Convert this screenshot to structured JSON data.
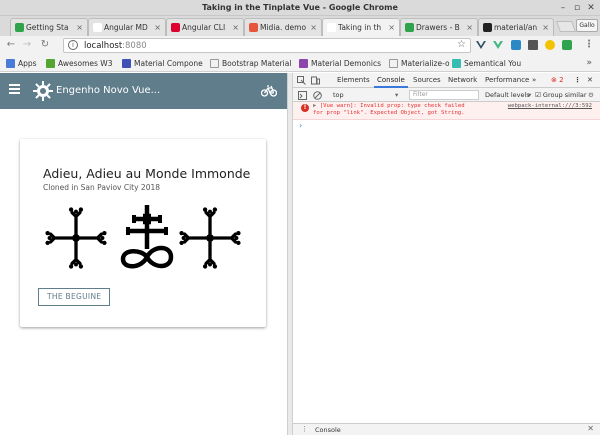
{
  "window": {
    "title": "Taking in the Tinplate Vue - Google Chrome"
  },
  "tabs": [
    {
      "label": "Getting Sta",
      "color": "#2fa34b"
    },
    {
      "label": "Angular MD",
      "color": "#ffffff"
    },
    {
      "label": "Angular CLI",
      "color": "#dd0031"
    },
    {
      "label": "Midia. demo",
      "color": "#e8553f"
    },
    {
      "label": "Taking in th",
      "color": "#ffffff",
      "active": true
    },
    {
      "label": "Drawers - B",
      "color": "#2fa34b"
    },
    {
      "label": "material/an",
      "color": "#222222"
    }
  ],
  "toolbar": {
    "url_host": "localhost",
    "url_port": ":8080",
    "profile_label": "Gallo"
  },
  "bookmarks": {
    "items": [
      {
        "label": "Apps",
        "color": "#4a7bd8"
      },
      {
        "label": "Awesomes W3",
        "color": "#55a630"
      },
      {
        "label": "Material Compone",
        "color": "#3f51b5"
      },
      {
        "label": "Bootstrap Material",
        "color": "#ffffff"
      },
      {
        "label": "Material Demonics",
        "color": "#8e44ad"
      },
      {
        "label": "Materialize-o",
        "color": "#ffffff"
      },
      {
        "label": "Semantical You",
        "color": "#35bdb2"
      }
    ],
    "more": "»"
  },
  "app": {
    "title": "Engenho Novo Vue...",
    "bar_color": "#607d8b"
  },
  "card": {
    "title": "Adieu, Adieu au Monde Immonde",
    "subtitle": "Cloned in San Paviov City 2018",
    "button_label": "THE BEGUINE"
  },
  "devtools": {
    "tabs": [
      "Elements",
      "Console",
      "Sources",
      "Network",
      "Performance"
    ],
    "active_tab": "Console",
    "more_tabs": "»",
    "error_count": "2",
    "context": "top",
    "filter_placeholder": "Filter",
    "levels": "Default levels",
    "group_similar": "Group similar",
    "message": "[Vue warn]: Invalid prop: type check failed for prop \"link\". Expected Object, got String.",
    "message_source": "webpack-internal:///3:592",
    "prompt": "›",
    "drawer_tab": "Console"
  }
}
